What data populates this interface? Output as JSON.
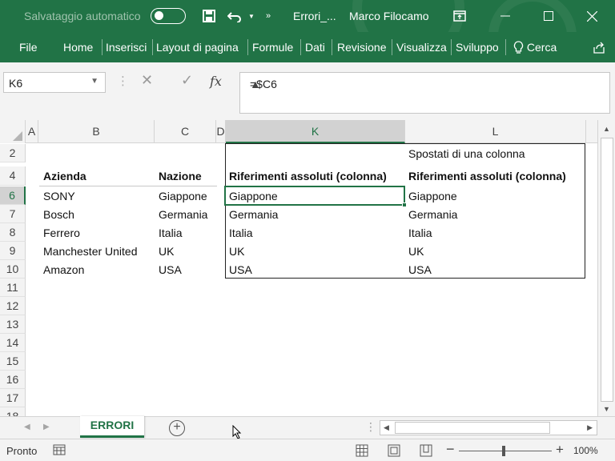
{
  "titlebar": {
    "autosave_label": "Salvataggio automatico",
    "file_name": "Errori_...",
    "user_name": "Marco Filocamo"
  },
  "ribbon": {
    "tabs": [
      "File",
      "Home",
      "Inserisci",
      "Layout di pagina",
      "Formule",
      "Dati",
      "Revisione",
      "Visualizza",
      "Sviluppo",
      "Cerca"
    ]
  },
  "formula_bar": {
    "name_box": "K6",
    "fx_label": "fx",
    "formula": "=$C6"
  },
  "grid": {
    "columns": [
      "A",
      "B",
      "C",
      "D",
      "K",
      "L"
    ],
    "rows": [
      "2",
      "4",
      "6",
      "7",
      "8",
      "9",
      "10",
      "11",
      "12",
      "13",
      "14",
      "15",
      "16",
      "17",
      "18"
    ],
    "active_cell": "K6",
    "l2_note": "Spostati di una colonna",
    "headers": {
      "b": "Azienda",
      "c": "Nazione",
      "k": "Riferimenti assoluti (colonna)",
      "l": "Riferimenti assoluti (colonna)"
    },
    "data_rows": [
      {
        "b": "SONY",
        "c": "Giappone",
        "k": "Giappone",
        "l": "Giappone"
      },
      {
        "b": "Bosch",
        "c": "Germania",
        "k": "Germania",
        "l": "Germania"
      },
      {
        "b": "Ferrero",
        "c": "Italia",
        "k": "Italia",
        "l": "Italia"
      },
      {
        "b": "Manchester United",
        "c": "UK",
        "k": "UK",
        "l": "UK"
      },
      {
        "b": "Amazon",
        "c": "USA",
        "k": "USA",
        "l": "USA"
      }
    ]
  },
  "sheets": {
    "active": "ERRORI"
  },
  "status": {
    "text": "Pronto",
    "zoom": "100%"
  },
  "colors": {
    "accent": "#217346"
  }
}
